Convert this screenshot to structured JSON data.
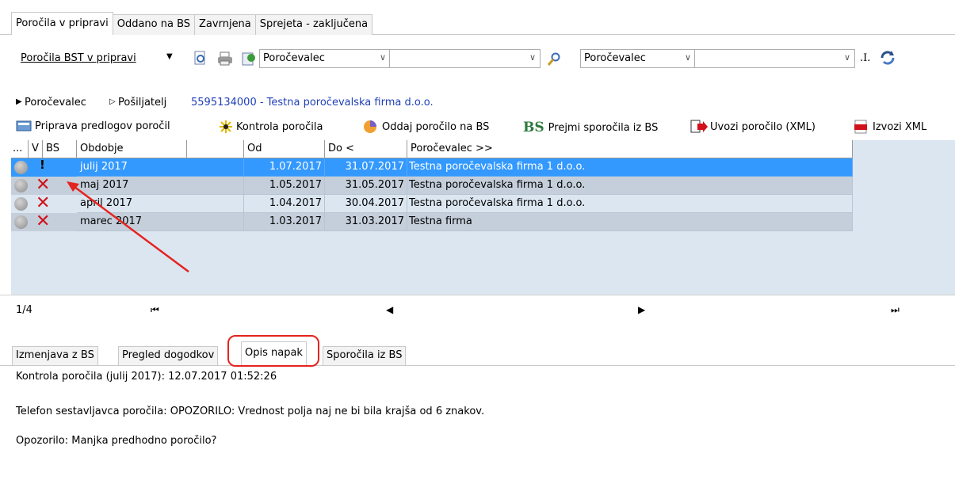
{
  "top_tabs": [
    "Poročila v pripravi",
    "Oddano na BS",
    "Zavrnjena",
    "Sprejeta - zaključena"
  ],
  "toolbar": {
    "view_selector": "Poročila BST v pripravi",
    "filter1_field": "Poročevalec",
    "filter1_value": "",
    "filter2_field": "Poročevalec",
    "filter2_value": "",
    "dot_label": ".I."
  },
  "breadcrumb": {
    "item1": "Poročevalec",
    "item2": "Pošiljatelj",
    "entity": "5595134000 - Testna poročevalska firma d.o.o."
  },
  "actions": [
    {
      "label": "Priprava predlogov poročil",
      "icon": "calculator-icon"
    },
    {
      "label": "Kontrola poročila",
      "icon": "sparkle-icon"
    },
    {
      "label": "Oddaj poročilo na BS",
      "icon": "pie-icon"
    },
    {
      "label": "Prejmi sporočila iz BS",
      "icon": "bs-icon"
    },
    {
      "label": "Uvozi poročilo (XML)",
      "icon": "import-icon"
    },
    {
      "label": "Izvozi XML",
      "icon": "xml-icon"
    }
  ],
  "grid": {
    "columns": [
      "...",
      "V",
      "BS",
      "Obdobje",
      "Od",
      "Do  <",
      "Poročevalec  >>"
    ],
    "rows": [
      {
        "status": "warning",
        "obdobje": "julij 2017",
        "od": "1.07.2017",
        "do": "31.07.2017",
        "porocevalec": "Testna poročevalska firma 1 d.o.o.",
        "selected": true
      },
      {
        "status": "error",
        "obdobje": "maj 2017",
        "od": "1.05.2017",
        "do": "31.05.2017",
        "porocevalec": "Testna poročevalska firma 1 d.o.o.",
        "selected": false
      },
      {
        "status": "error",
        "obdobje": "april 2017",
        "od": "1.04.2017",
        "do": "30.04.2017",
        "porocevalec": "Testna poročevalska firma 1 d.o.o.",
        "selected": false
      },
      {
        "status": "error",
        "obdobje": "marec 2017",
        "od": "1.03.2017",
        "do": "31.03.2017",
        "porocevalec": "Testna firma",
        "selected": false
      }
    ]
  },
  "pager": {
    "position": "1/4"
  },
  "bottom_tabs": [
    "Izmenjava z BS",
    "Pregled dogodkov",
    "Opis napak",
    "Sporočila iz BS"
  ],
  "messages": [
    "Kontrola poročila (julij 2017): 12.07.2017 01:52:26",
    "Telefon sestavljavca poročila: OPOZORILO: Vrednost polja naj ne bi bila krajša od 6 znakov.",
    "Opozorilo: Manjka predhodno poročilo?"
  ],
  "colors": {
    "selected_row": "#3399ff",
    "grid_bg": "#dbe6f1",
    "highlight": "#e4231f",
    "link": "#1f3fb5"
  }
}
